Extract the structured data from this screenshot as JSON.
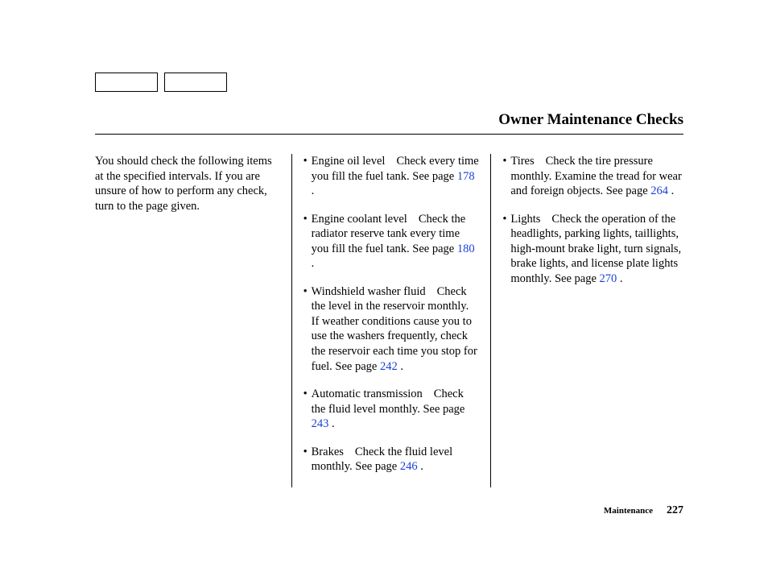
{
  "title": "Owner Maintenance Checks",
  "intro": "You should check the following items at the specified intervals. If you are unsure of how to perform any check, turn to the page given.",
  "col2": {
    "items": [
      {
        "label": "Engine oil level",
        "text1": "Check every time you fill the fuel tank. See page ",
        "page": "178",
        "text2": " ."
      },
      {
        "label": "Engine coolant level",
        "text1": "Check the radiator reserve tank every time you fill the fuel tank. See page ",
        "page": "180",
        "text2": " ."
      },
      {
        "label": "Windshield washer fluid",
        "text1": "Check the level in the reservoir monthly. If weather conditions cause you to use the washers frequently, check the reservoir each time you stop for fuel. See page ",
        "page": "242",
        "text2": " ."
      },
      {
        "label": "Automatic transmission",
        "text1": "Check the fluid level monthly. See page ",
        "page": "243",
        "text2": " ."
      },
      {
        "label": "Brakes",
        "text1": "Check the fluid level monthly. See page ",
        "page": "246",
        "text2": " ."
      }
    ]
  },
  "col3": {
    "items": [
      {
        "label": "Tires",
        "text1": "Check the tire pressure monthly. Examine the tread for wear and foreign objects. See page ",
        "page": "264",
        "text2": " ."
      },
      {
        "label": "Lights",
        "text1": "Check the operation of the headlights, parking lights, taillights, high-mount brake light, turn signals, brake lights, and license plate lights monthly. See page ",
        "page": "270",
        "text2": " ."
      }
    ]
  },
  "footer": {
    "section": "Maintenance",
    "page": "227"
  }
}
